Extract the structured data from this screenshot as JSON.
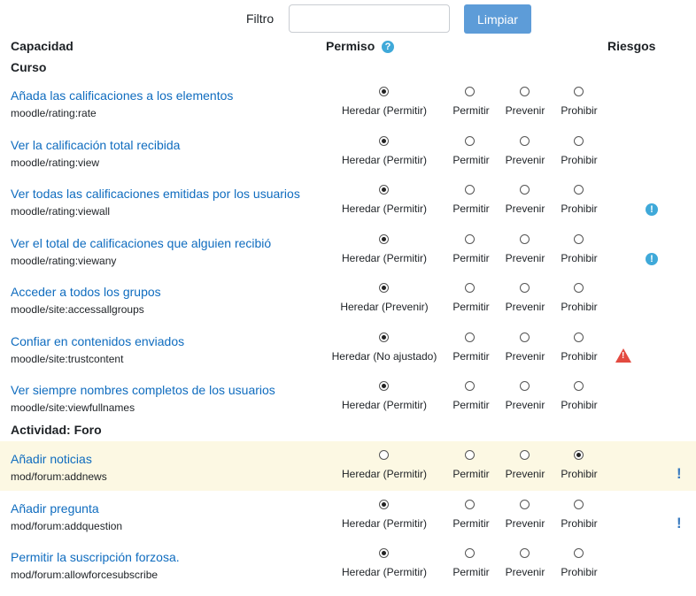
{
  "filter": {
    "label": "Filtro",
    "value": "",
    "placeholder": ""
  },
  "clear_button": "Limpiar",
  "headers": {
    "capability": "Capacidad",
    "permission": "Permiso",
    "risks": "Riesgos",
    "help_glyph": "?"
  },
  "sections": [
    {
      "title": "Curso",
      "rows": [
        {
          "name": "Añada las calificaciones a los elementos",
          "id": "moodle/rating:rate",
          "inherit": "Heredar (Permitir)",
          "selected": 0,
          "risk": ""
        },
        {
          "name": "Ver la calificación total recibida",
          "id": "moodle/rating:view",
          "inherit": "Heredar (Permitir)",
          "selected": 0,
          "risk": ""
        },
        {
          "name": "Ver todas las calificaciones emitidas por los usuarios",
          "id": "moodle/rating:viewall",
          "inherit": "Heredar (Permitir)",
          "selected": 0,
          "risk": "info-icon"
        },
        {
          "name": "Ver el total de calificaciones que alguien recibió",
          "id": "moodle/rating:viewany",
          "inherit": "Heredar (Permitir)",
          "selected": 0,
          "risk": "info-icon"
        },
        {
          "name": "Acceder a todos los grupos",
          "id": "moodle/site:accessallgroups",
          "inherit": "Heredar (Prevenir)",
          "selected": 0,
          "risk": ""
        },
        {
          "name": "Confiar en contenidos enviados",
          "id": "moodle/site:trustcontent",
          "inherit": "Heredar (No ajustado)",
          "selected": 0,
          "risk": "warning-triangle-icon"
        },
        {
          "name": "Ver siempre nombres completos de los usuarios",
          "id": "moodle/site:viewfullnames",
          "inherit": "Heredar (Permitir)",
          "selected": 0,
          "risk": ""
        }
      ]
    },
    {
      "title": "Actividad: Foro",
      "rows": [
        {
          "name": "Añadir noticias",
          "id": "mod/forum:addnews",
          "inherit": "Heredar (Permitir)",
          "selected": 3,
          "risk": "exclamation-icon",
          "highlight": true
        },
        {
          "name": "Añadir pregunta",
          "id": "mod/forum:addquestion",
          "inherit": "Heredar (Permitir)",
          "selected": 0,
          "risk": "exclamation-icon"
        },
        {
          "name": "Permitir la suscripción forzosa.",
          "id": "mod/forum:allowforcesubscribe",
          "inherit": "Heredar (Permitir)",
          "selected": 0,
          "risk": ""
        }
      ]
    }
  ],
  "options": [
    "Permitir",
    "Prevenir",
    "Prohibir"
  ],
  "colors": {
    "link": "#0f6cbf",
    "button": "#5d9cd8",
    "highlight": "#fcf8e3",
    "info": "#3fa9d9",
    "danger": "#e34a40"
  }
}
